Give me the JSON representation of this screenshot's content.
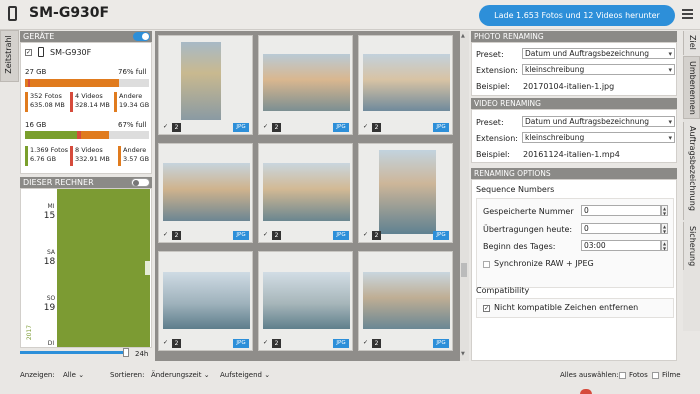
{
  "header": {
    "device_title": "SM-G930F",
    "download_button": "Lade 1.653 Fotos und 12 Videos herunter"
  },
  "left_tab": {
    "label": "Zeitstrahl"
  },
  "devices": {
    "title": "GERÄTE",
    "device_name": "SM-G930F",
    "storage1": {
      "size": "27 GB",
      "usage": "76% full",
      "photos": "352 Fotos",
      "photos_size": "635.08 MB",
      "videos": "4 Videos",
      "videos_size": "328.14 MB",
      "other": "Andere",
      "other_size": "19.34 GB"
    },
    "storage2": {
      "size": "16 GB",
      "usage": "67% full",
      "photos": "1.369 Fotos",
      "photos_size": "6.76 GB",
      "videos": "8 Videos",
      "videos_size": "332.91 MB",
      "other": "Andere",
      "other_size": "3.57 GB"
    }
  },
  "computer": {
    "title": "DIESER RECHNER",
    "days": [
      {
        "name": "MI",
        "num": "15"
      },
      {
        "name": "SA",
        "num": "18"
      },
      {
        "name": "SO",
        "num": "19"
      },
      {
        "name": "DI",
        "num": ""
      }
    ],
    "year_vertical": "2017",
    "slider_label": "24h"
  },
  "thumbnails": [
    {
      "count": "2",
      "type": "JPG"
    },
    {
      "count": "2",
      "type": "JPG"
    },
    {
      "count": "2",
      "type": "JPG"
    },
    {
      "count": "2",
      "type": "JPG"
    },
    {
      "count": "2",
      "type": "JPG"
    },
    {
      "count": "2",
      "type": "JPG"
    },
    {
      "count": "2",
      "type": "JPG"
    },
    {
      "count": "2",
      "type": "JPG"
    },
    {
      "count": "2",
      "type": "JPG"
    }
  ],
  "photo_renaming": {
    "title": "PHOTO RENAMING",
    "preset_label": "Preset:",
    "preset_value": "Datum und Auftragsbezeichnung",
    "extension_label": "Extension:",
    "extension_value": "kleinschreibung",
    "example_label": "Beispiel:",
    "example_value": "20170104-italien-1.jpg"
  },
  "video_renaming": {
    "title": "VIDEO RENAMING",
    "preset_label": "Preset:",
    "preset_value": "Datum und Auftragsbezeichnung",
    "extension_label": "Extension:",
    "extension_value": "kleinschreibung",
    "example_label": "Beispiel:",
    "example_value": "20161124-italien-1.mp4"
  },
  "renaming_options": {
    "title": "RENAMING OPTIONS",
    "sequence_title": "Sequence Numbers",
    "stored_label": "Gespeicherte Nummer",
    "stored_value": "0",
    "transfers_label": "Übertragungen heute:",
    "transfers_value": "0",
    "day_start_label": "Beginn des Tages:",
    "day_start_value": "03:00",
    "sync_label": "Synchronize RAW + JPEG",
    "compat_title": "Compatibility",
    "compat_label": "Nicht kompatible Zeichen entfernen"
  },
  "right_tabs": [
    "Ziel",
    "Umbenennen",
    "Auftragsbezeichnung",
    "Sicherung"
  ],
  "bottom": {
    "show_label": "Anzeigen:",
    "show_value": "Alle",
    "sort_label": "Sortieren:",
    "sort_value": "Änderungszeit",
    "order_value": "Aufsteigend",
    "select_all_label": "Alles auswählen:",
    "photos_label": "Fotos",
    "videos_label": "Filme"
  },
  "colors": {
    "accent": "#2d8fd9",
    "photos": "#e07b1e",
    "videos": "#d64b3c",
    "other": "#7a9f2c"
  }
}
